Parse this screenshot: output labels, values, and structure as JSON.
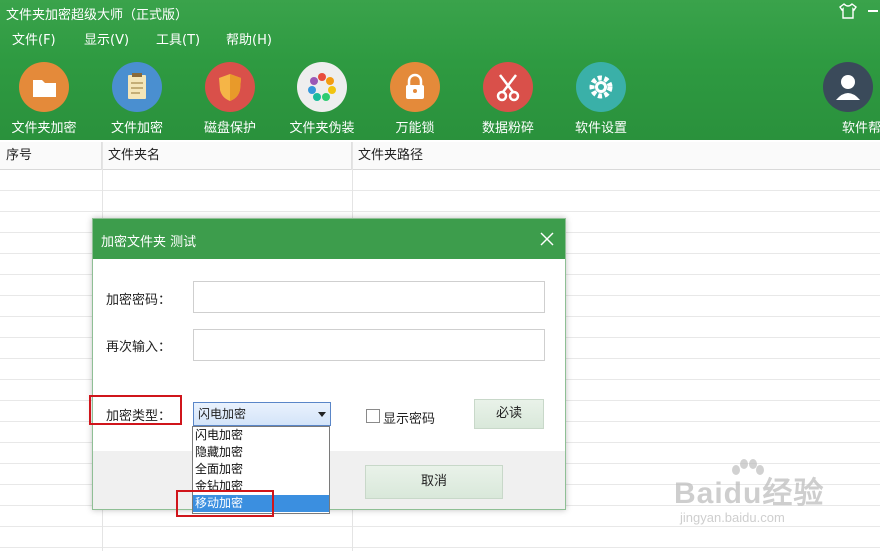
{
  "window": {
    "title": "文件夹加密超级大师（正式版）"
  },
  "menu": [
    {
      "label": "文件(F)"
    },
    {
      "label": "显示(V)"
    },
    {
      "label": "工具(T)"
    },
    {
      "label": "帮助(H)"
    }
  ],
  "toolbar": [
    {
      "label": "文件夹加密",
      "icon": "folder-icon",
      "color": "#e48a3a"
    },
    {
      "label": "文件加密",
      "icon": "document-icon",
      "color": "#4a8fd0"
    },
    {
      "label": "磁盘保护",
      "icon": "shield-icon",
      "color": "#d9504a"
    },
    {
      "label": "文件夹伪装",
      "icon": "color-wheel-icon",
      "color": "#e9e9e9"
    },
    {
      "label": "万能锁",
      "icon": "lock-icon",
      "color": "#e48a3a"
    },
    {
      "label": "数据粉碎",
      "icon": "scissors-icon",
      "color": "#d9504a"
    },
    {
      "label": "软件设置",
      "icon": "gear-icon",
      "color": "#3ab0a8"
    },
    {
      "label": "软件帮",
      "icon": "user-icon",
      "color": "#3a4a5a"
    }
  ],
  "table": {
    "columns": [
      "序号",
      "文件夹名",
      "文件夹路径"
    ]
  },
  "dialog": {
    "title": "加密文件夹 测试",
    "password_label": "加密密码：",
    "password_value": "",
    "confirm_label": "再次输入：",
    "confirm_value": "",
    "type_label": "加密类型：",
    "selected_type": "闪电加密",
    "show_password_label": "显示密码",
    "show_password_checked": false,
    "must_read_label": "必读",
    "cancel_label": "取消",
    "type_options": [
      {
        "label": "闪电加密"
      },
      {
        "label": "隐藏加密"
      },
      {
        "label": "全面加密"
      },
      {
        "label": "金钻加密"
      },
      {
        "label": "移动加密",
        "highlighted": true
      }
    ]
  },
  "watermark": {
    "brand": "Baidu经验",
    "url": "jingyan.baidu.com"
  },
  "colors": {
    "header_green": "#2e9a41",
    "dialog_title_green": "#3d9d4c",
    "highlight_blue": "#3b8fe0",
    "annotation_red": "#d0151b"
  }
}
